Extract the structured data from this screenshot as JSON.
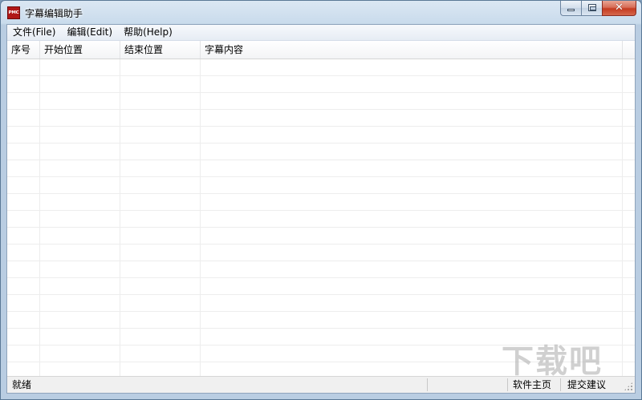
{
  "window": {
    "title": "字幕编辑助手",
    "app_icon_text": "PMC"
  },
  "menubar": {
    "items": [
      {
        "label": "文件(File)"
      },
      {
        "label": "编辑(Edit)"
      },
      {
        "label": "帮助(Help)"
      }
    ]
  },
  "listview": {
    "columns": [
      {
        "label": "序号"
      },
      {
        "label": "开始位置"
      },
      {
        "label": "结束位置"
      },
      {
        "label": "字幕内容"
      }
    ],
    "rows": []
  },
  "statusbar": {
    "status_text": "就绪",
    "homepage_link": "软件主页",
    "feedback_link": "提交建议"
  },
  "watermark": {
    "text": "下载吧"
  },
  "colors": {
    "title_bar": "#dbe7f3",
    "close_button": "#c43b20",
    "app_icon": "#b01818"
  }
}
